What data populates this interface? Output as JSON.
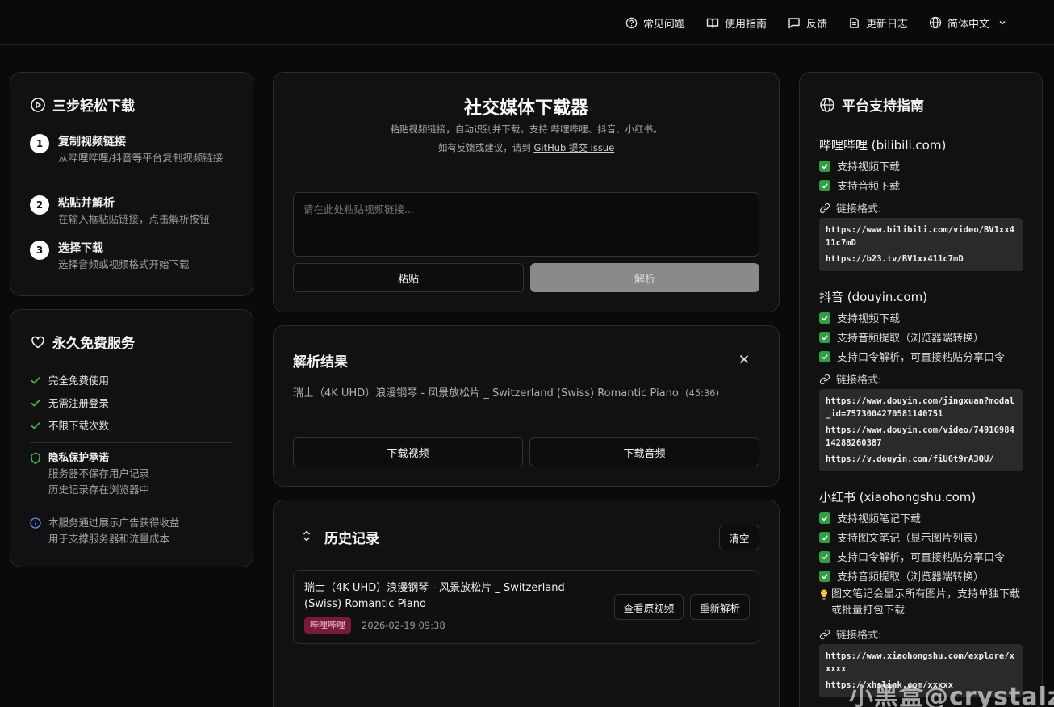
{
  "nav": {
    "faq": "常见问题",
    "guide": "使用指南",
    "feedback": "反馈",
    "changelog": "更新日志",
    "language": "简体中文"
  },
  "steps_panel": {
    "title": "三步轻松下载",
    "steps": [
      {
        "num": "1",
        "title": "复制视频链接",
        "desc": "从哔哩哔哩/抖音等平台复制视频链接"
      },
      {
        "num": "2",
        "title": "粘贴并解析",
        "desc": "在输入框粘贴链接，点击解析按钮"
      },
      {
        "num": "3",
        "title": "选择下载",
        "desc": "选择音频或视频格式开始下载"
      }
    ]
  },
  "free_panel": {
    "title": "永久免费服务",
    "checks": [
      "完全免费使用",
      "无需注册登录",
      "不限下载次数"
    ],
    "privacy_title": "隐私保护承诺",
    "privacy_lines": [
      "服务器不保存用户记录",
      "历史记录存在浏览器中"
    ],
    "info_lines": [
      "本服务通过展示广告获得收益",
      "用于支撑服务器和流量成本"
    ]
  },
  "main": {
    "title": "社交媒体下载器",
    "subtitle": "粘贴视频链接，自动识别并下载。支持 哔哩哔哩、抖音、小红书。",
    "feedback_prefix": "如有反馈或建议，请到 ",
    "feedback_link": "GitHub 提交 issue",
    "input_placeholder": "请在此处粘贴视频链接...",
    "paste_label": "粘贴",
    "parse_label": "解析"
  },
  "result": {
    "title": "解析结果",
    "video_title": "瑞士（4K UHD）浪漫钢琴 - 风景放松片 _ Switzerland (Swiss) Romantic Piano",
    "duration": "(45:36)",
    "download_video": "下载视频",
    "download_audio": "下载音频"
  },
  "history": {
    "title": "历史记录",
    "clear_label": "清空",
    "items": [
      {
        "title": "瑞士（4K UHD）浪漫钢琴 - 风景放松片 _ Switzerland (Swiss) Romantic Piano",
        "platform": "哔哩哔哩",
        "time": "2026-02-19 09:38",
        "view_label": "查看原视频",
        "reparse_label": "重新解析"
      }
    ]
  },
  "platforms": {
    "title": "平台支持指南",
    "format_label": "链接格式:",
    "bilibili": {
      "name": "哔哩哔哩 (bilibili.com)",
      "features": [
        "支持视频下载",
        "支持音频下载"
      ],
      "formats": [
        "https://www.bilibili.com/video/BV1xx411c7mD",
        "https://b23.tv/BV1xx411c7mD"
      ]
    },
    "douyin": {
      "name": "抖音 (douyin.com)",
      "features": [
        "支持视频下载",
        "支持音频提取（浏览器端转换）",
        "支持口令解析，可直接粘贴分享口令"
      ],
      "formats": [
        "https://www.douyin.com/jingxuan?modal_id=7573004270581140751",
        "https://www.douyin.com/video/7491698414288260387",
        "https://v.douyin.com/fiU6t9rA3QU/"
      ]
    },
    "xiaohongshu": {
      "name": "小红书 (xiaohongshu.com)",
      "features": [
        "支持视频笔记下载",
        "支持图文笔记（显示图片列表）",
        "支持口令解析，可直接粘贴分享口令",
        "支持音频提取（浏览器端转换）"
      ],
      "tip": "图文笔记会显示所有图片，支持单独下载或批量打包下载",
      "formats": [
        "https://www.xiaohongshu.com/explore/xxxxx",
        "https://xhslink.com/xxxxx"
      ]
    }
  },
  "watermark": "小黑盒@crystalz",
  "colors": {
    "background": "#0a0a0a",
    "panel": "#111111",
    "border": "#2b2b2b",
    "check_green": "#2ea043",
    "tag_bg": "#7a1a3a",
    "parse_button": "#8a8a8a"
  }
}
